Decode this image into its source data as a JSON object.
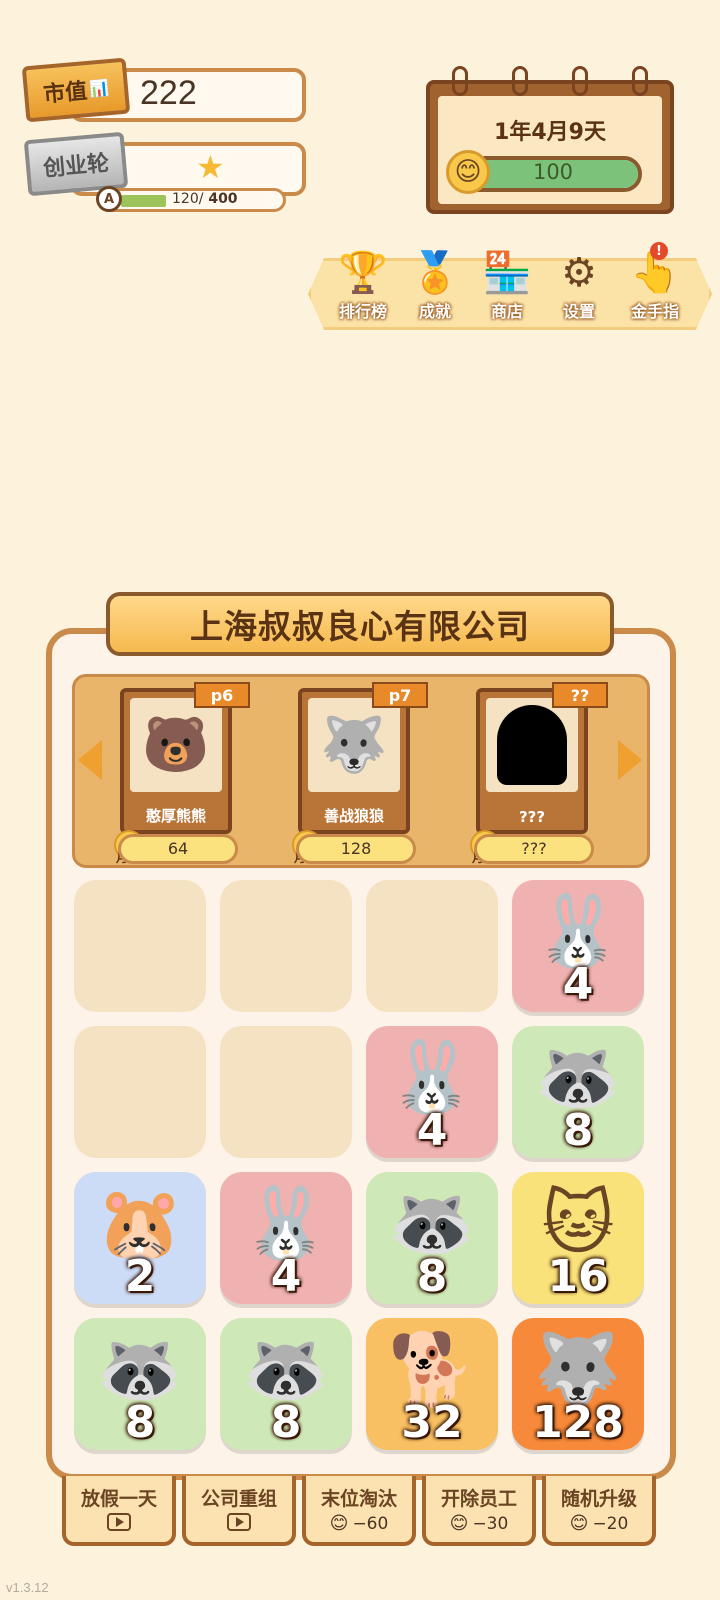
{
  "stats": {
    "market_cap_label": "市值",
    "market_cap_value": "222",
    "round_label": "创业轮",
    "grade": "A",
    "exp_current": "120/",
    "exp_max": " 400",
    "exp_fraction": 0.3
  },
  "calendar": {
    "date": "1年4月9天",
    "mood_value": "100",
    "mood_fraction": 1.0
  },
  "menu": [
    {
      "label": "排行榜",
      "icon": "trophy-icon"
    },
    {
      "label": "成就",
      "icon": "medal-icon"
    },
    {
      "label": "商店",
      "icon": "shop-icon"
    },
    {
      "label": "设置",
      "icon": "gear-icon"
    },
    {
      "label": "金手指",
      "icon": "golden-finger-icon",
      "alert": "!"
    }
  ],
  "company_name": "上海叔叔良心有限公司",
  "employees": [
    {
      "rank": "p6",
      "name": "憨厚熊熊",
      "salary": "64",
      "salary_label": "月薪",
      "icon": "🐻"
    },
    {
      "rank": "p7",
      "name": "善战狼狼",
      "salary": "128",
      "salary_label": "月薪",
      "icon": "🐺"
    },
    {
      "rank": "??",
      "name": "???",
      "salary": "???",
      "salary_label": "月薪",
      "icon": "silhouette"
    }
  ],
  "grid": [
    [
      "",
      "",
      "",
      "4"
    ],
    [
      "",
      "",
      "4",
      "8"
    ],
    [
      "2",
      "4",
      "8",
      "16"
    ],
    [
      "8",
      "8",
      "32",
      "128"
    ]
  ],
  "tile_icons": {
    "2": "🐹",
    "4": "🐰",
    "8": "🦝",
    "16": "🐱",
    "32": "🐕",
    "128": "🐺"
  },
  "actions": [
    {
      "label": "放假一天",
      "type": "video"
    },
    {
      "label": "公司重组",
      "type": "video"
    },
    {
      "label": "末位淘汰",
      "type": "mood",
      "cost": "−60"
    },
    {
      "label": "开除员工",
      "type": "mood",
      "cost": "−30"
    },
    {
      "label": "随机升级",
      "type": "mood",
      "cost": "−20"
    }
  ],
  "version": "v1.3.12"
}
